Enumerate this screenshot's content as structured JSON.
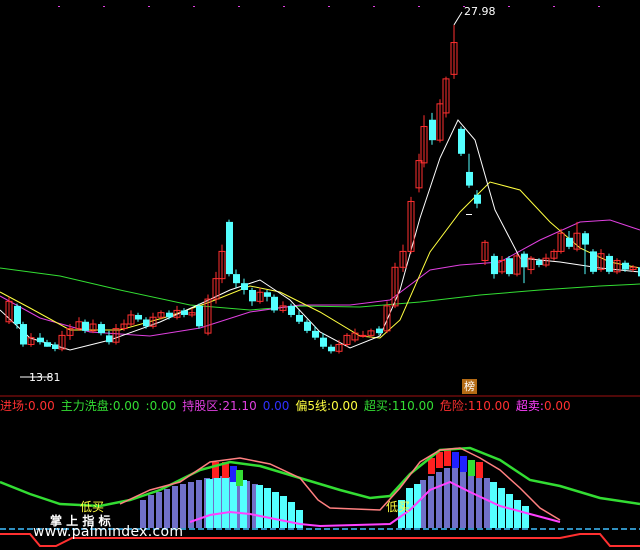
{
  "price_panel": {
    "high_label": "27.98",
    "low_label": "13.81",
    "badge": "榜"
  },
  "indicator_legend": [
    {
      "label": "进场:",
      "value": "0.00",
      "color": "#ff3030"
    },
    {
      "label": "主力洗盘:",
      "value": "0.00",
      "color": "#33dd33"
    },
    {
      "label": ":",
      "value": "0.00",
      "color": "#33dd33"
    },
    {
      "label": "持股区:",
      "value": "21.10",
      "color": "#e040e0"
    },
    {
      "label": "",
      "value": "0.00",
      "color": "#3030ff"
    },
    {
      "label": "偏5线:",
      "value": "0.00",
      "color": "#ffff40"
    },
    {
      "label": "超买:",
      "value": "110.00",
      "color": "#33dd33"
    },
    {
      "label": "危险:",
      "value": "110.00",
      "color": "#ff3030"
    },
    {
      "label": "超卖:",
      "value": "0.00",
      "color": "#ff40ff"
    }
  ],
  "indicator_panel": {
    "low_buy_1": "低买",
    "low_buy_2": "低买",
    "brand_text": "掌 上 指 标",
    "watermark": "www.palmindex.com"
  },
  "colors": {
    "up": "#ff3030",
    "down": "#54ffff",
    "ma_white": "#ffffff",
    "ma_yellow": "#ffff40",
    "ma_magenta": "#e040e0",
    "ma_green": "#33dd33",
    "separator": "#a01010"
  }
}
